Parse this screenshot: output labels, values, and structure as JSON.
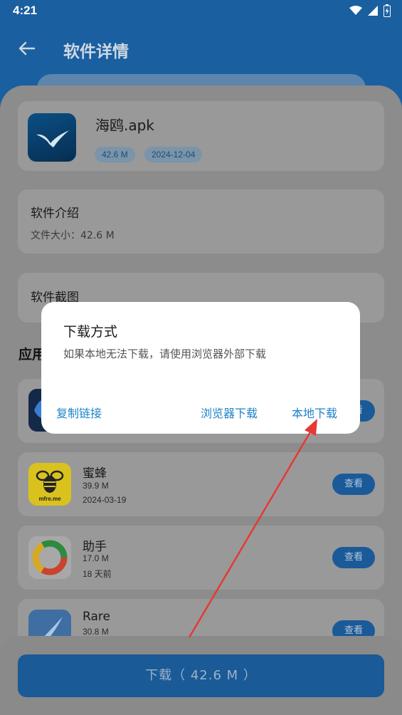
{
  "status_bar": {
    "time": "4:21"
  },
  "header": {
    "title": "软件详情"
  },
  "apk": {
    "name": "海鸥.apk",
    "size": "42.6 M",
    "date": "2024-12-04"
  },
  "intro": {
    "title": "软件介绍",
    "file_size": "文件大小：42.6 M"
  },
  "screenshots": {
    "title": "软件截图"
  },
  "apps_heading": "应用",
  "apps": [
    {
      "name": "",
      "size": "",
      "date": "",
      "button": "查看",
      "icon": "app-icon-dark"
    },
    {
      "name": "蜜蜂",
      "size": "39.9 M",
      "date": "2024-03-19",
      "button": "查看",
      "icon": "bee-icon",
      "icon_text": "mfre.me"
    },
    {
      "name": "助手",
      "size": "17.0 M",
      "date": "18 天前",
      "button": "查看",
      "icon": "ring-icon"
    },
    {
      "name": "Rare",
      "size": "30.8 M",
      "date": "",
      "button": "查看",
      "icon": "comet-icon"
    }
  ],
  "download_button": "下载（ 42.6 M ）",
  "dialog": {
    "title": "下载方式",
    "message": "如果本地无法下载，请使用浏览器外部下载",
    "copy_link": "复制链接",
    "browser_download": "浏览器下载",
    "local_download": "本地下载"
  },
  "colors": {
    "primary": "#1d6fc2",
    "dialog_button": "#1d83c9",
    "arrow": "#e53935"
  }
}
